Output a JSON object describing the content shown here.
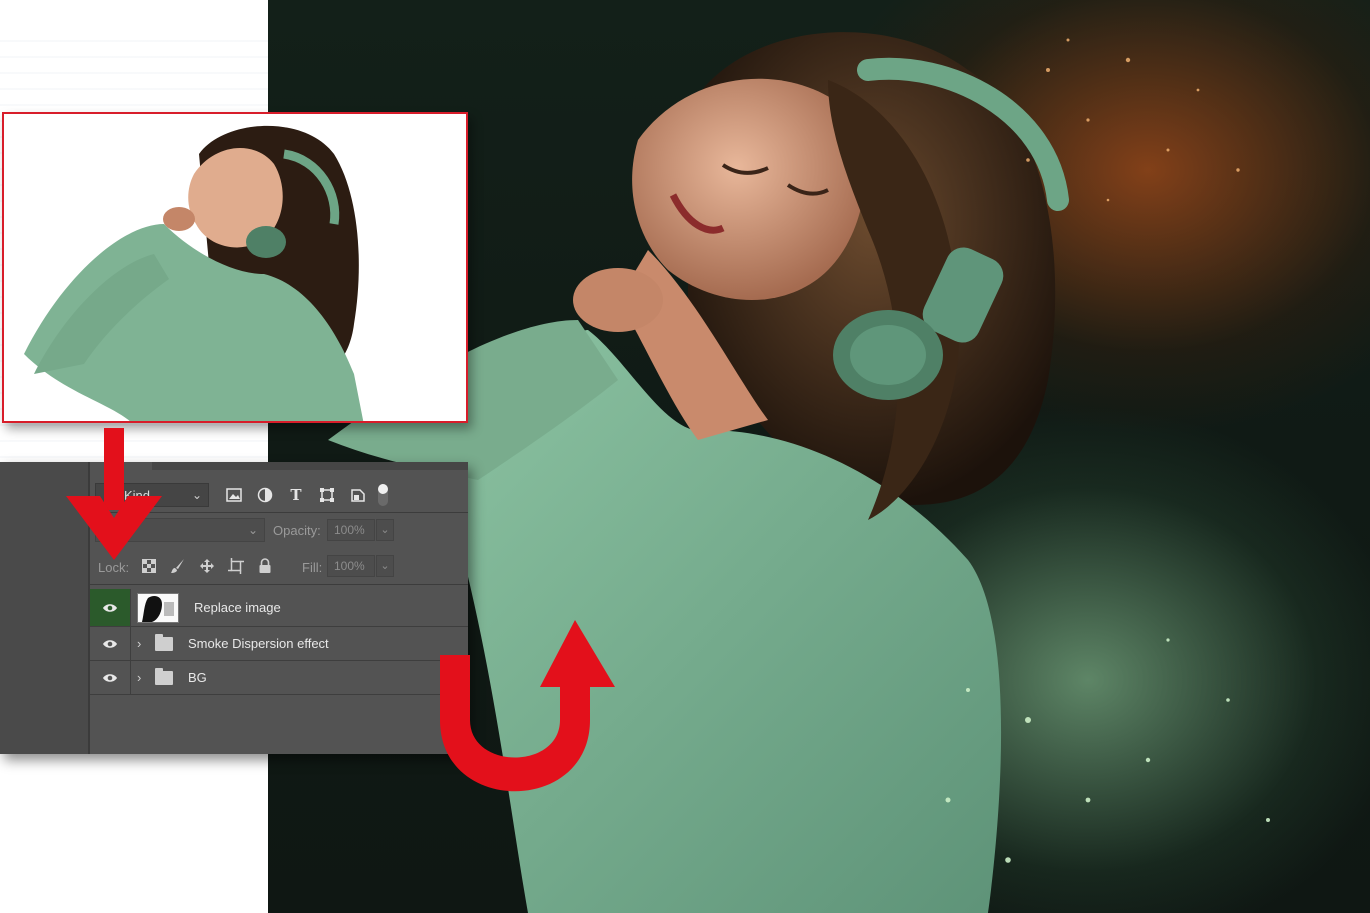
{
  "layers_panel": {
    "filter_kind_label": "Kind",
    "opacity_label": "Opacity:",
    "opacity_value": "100%",
    "lock_label": "Lock:",
    "fill_label": "Fill:",
    "fill_value": "100%",
    "filter_icons": [
      "image-filter-icon",
      "adjustment-filter-icon",
      "type-filter-icon",
      "shape-filter-icon",
      "smart-object-filter-icon",
      "filter-toggle"
    ],
    "lock_icons": [
      "lock-transparent-icon",
      "lock-pixels-icon",
      "lock-position-icon",
      "lock-artboard-icon",
      "lock-all-icon"
    ],
    "layers": [
      {
        "name": "Replace image",
        "type": "smart-object",
        "visible": true,
        "selected": true
      },
      {
        "name": "Smoke Dispersion effect",
        "type": "group",
        "visible": true,
        "selected": false
      },
      {
        "name": "BG",
        "type": "group",
        "visible": true,
        "selected": false
      }
    ]
  },
  "colors": {
    "accent_red": "#e3101b",
    "panel_bg": "#535353",
    "selected_eye_bg": "#2b5a2b",
    "hoodie_green": "#7fb394",
    "smoke_orange": "#8a4418",
    "smoke_green": "#8fb99a"
  }
}
